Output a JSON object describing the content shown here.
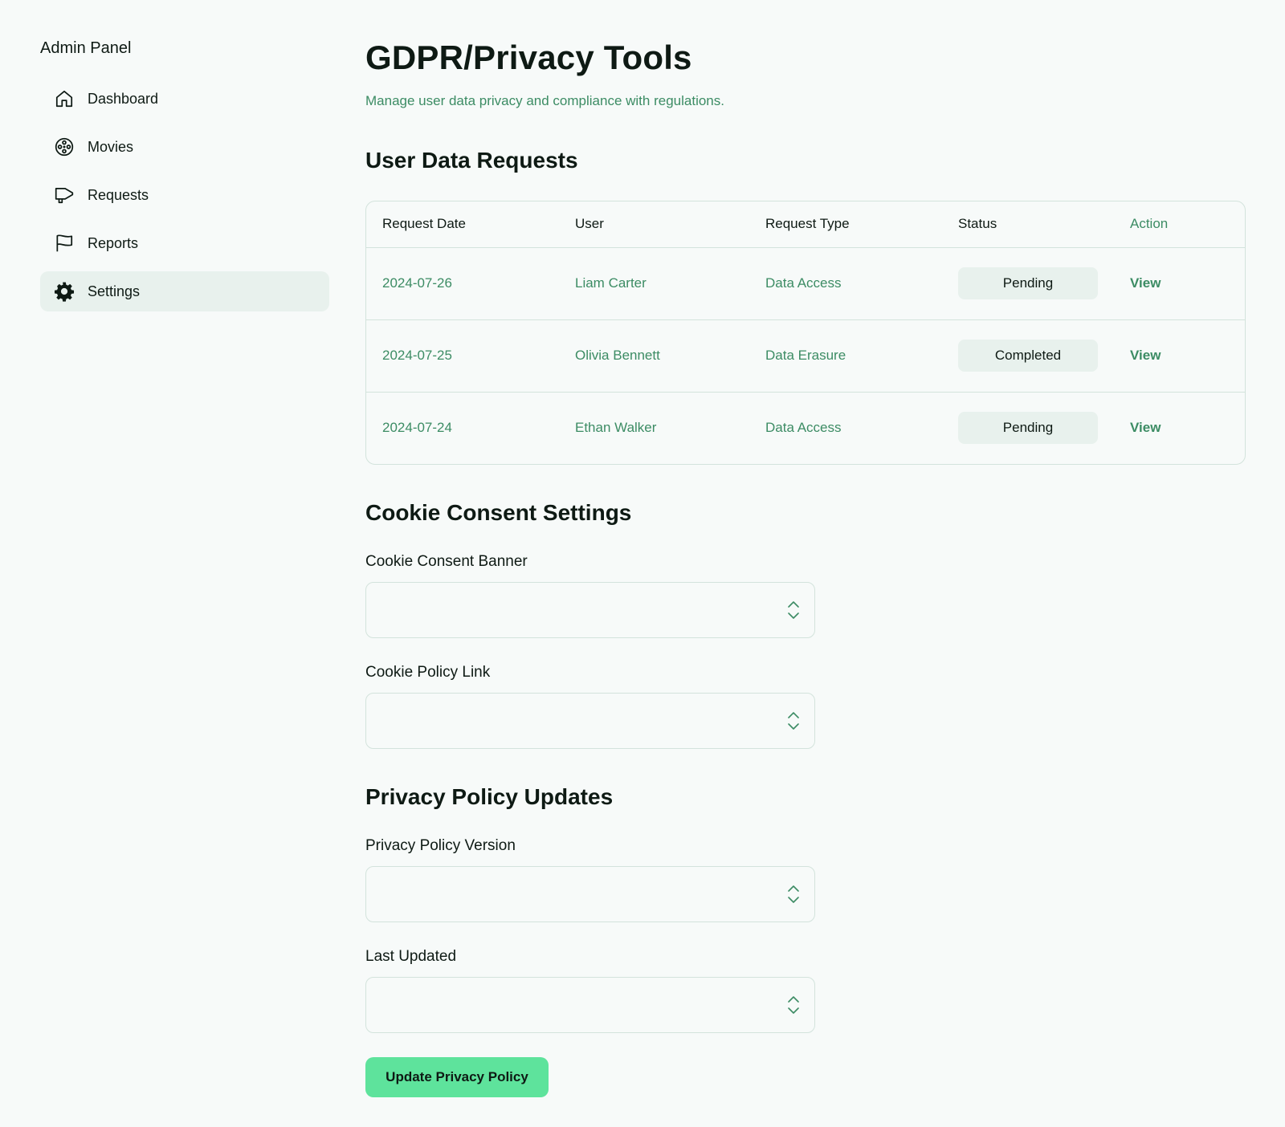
{
  "sidebar": {
    "title": "Admin Panel",
    "items": [
      {
        "label": "Dashboard",
        "icon": "house-icon"
      },
      {
        "label": "Movies",
        "icon": "film-reel-icon"
      },
      {
        "label": "Requests",
        "icon": "megaphone-icon"
      },
      {
        "label": "Reports",
        "icon": "flag-icon"
      },
      {
        "label": "Settings",
        "icon": "gear-icon",
        "active": true
      }
    ]
  },
  "header": {
    "title": "GDPR/Privacy Tools",
    "subtitle": "Manage user data privacy and compliance with regulations."
  },
  "requests": {
    "title": "User Data Requests",
    "columns": [
      "Request Date",
      "User",
      "Request Type",
      "Status",
      "Action"
    ],
    "rows": [
      {
        "date": "2024-07-26",
        "user": "Liam Carter",
        "type": "Data Access",
        "status": "Pending",
        "action": "View"
      },
      {
        "date": "2024-07-25",
        "user": "Olivia Bennett",
        "type": "Data Erasure",
        "status": "Completed",
        "action": "View"
      },
      {
        "date": "2024-07-24",
        "user": "Ethan Walker",
        "type": "Data Access",
        "status": "Pending",
        "action": "View"
      }
    ]
  },
  "cookies": {
    "title": "Cookie Consent Settings",
    "banner_label": "Cookie Consent Banner",
    "banner_value": "",
    "policy_link_label": "Cookie Policy Link",
    "policy_link_value": ""
  },
  "privacy": {
    "title": "Privacy Policy Updates",
    "version_label": "Privacy Policy Version",
    "version_value": "",
    "updated_label": "Last Updated",
    "updated_value": "",
    "submit_label": "Update Privacy Policy"
  },
  "colors": {
    "accent": "#3c8c64",
    "button": "#5ee39c",
    "pill": "#e8f1ed",
    "background": "#f7faf9",
    "border": "#d3e3dc"
  }
}
